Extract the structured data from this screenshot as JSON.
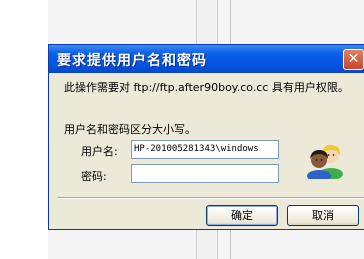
{
  "dialog": {
    "title": "要求提供用户名和密码",
    "close_glyph": "✕",
    "message": "此操作需要对 ftp://ftp.after90boy.co.cc 具有用户权限。",
    "case_note": "用户名和密码区分大小写。",
    "username_label": "用户名:",
    "username_value": "HP-201005281343\\windows",
    "password_label": "密码:",
    "password_value": "",
    "ok_label": "确定",
    "cancel_label": "取消",
    "avatar_icon": "users-icon"
  },
  "colors": {
    "titlebar": "#0554e0",
    "dialog_bg": "#ece9d8",
    "close_button": "#c7472a"
  }
}
